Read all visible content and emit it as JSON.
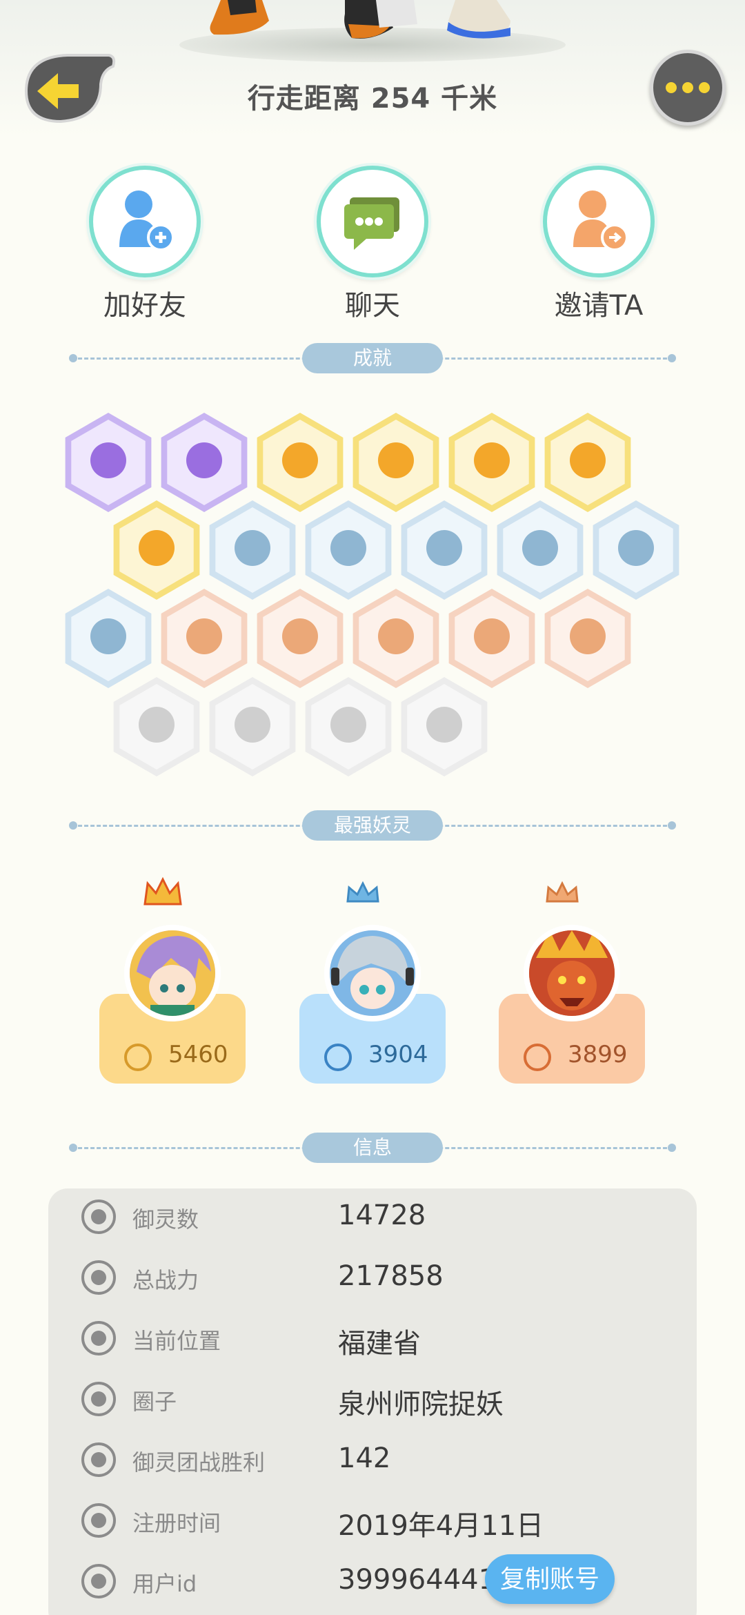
{
  "header": {
    "walk_distance": "行走距离 254 千米"
  },
  "actions": [
    {
      "label": "加好友",
      "icon": "add-friend-icon"
    },
    {
      "label": "聊天",
      "icon": "chat-icon"
    },
    {
      "label": "邀请TA",
      "icon": "invite-icon"
    }
  ],
  "sections": {
    "achievements": "成就",
    "strongest": "最强妖灵",
    "info": "信息"
  },
  "strongest_spirits": [
    {
      "power": "5460",
      "crown": "gold-crown-icon",
      "card_color": "#fcd98a",
      "text_color": "#9a6a1a",
      "icon_color": "#d79a2a"
    },
    {
      "power": "3904",
      "crown": "blue-crown-icon",
      "card_color": "#b9e0fb",
      "text_color": "#2d6a9a",
      "icon_color": "#3a83c4"
    },
    {
      "power": "3899",
      "crown": "copper-crown-icon",
      "card_color": "#fbcaa5",
      "text_color": "#a2542c",
      "icon_color": "#d86d35"
    }
  ],
  "info": [
    {
      "label": "御灵数",
      "value": "14728"
    },
    {
      "label": "总战力",
      "value": "217858"
    },
    {
      "label": "当前位置",
      "value": "福建省"
    },
    {
      "label": "圈子",
      "value": "泉州师院捉妖"
    },
    {
      "label": "御灵团战胜利",
      "value": "142"
    },
    {
      "label": "注册时间",
      "value": "2019年4月11日"
    },
    {
      "label": "用户id",
      "value": "39996444185"
    }
  ],
  "copy_button": "复制账号",
  "colors": {
    "accent_teal": "#7ee0cf",
    "divider_pill": "#a9c8dc",
    "copy_button": "#5ab4f0"
  }
}
